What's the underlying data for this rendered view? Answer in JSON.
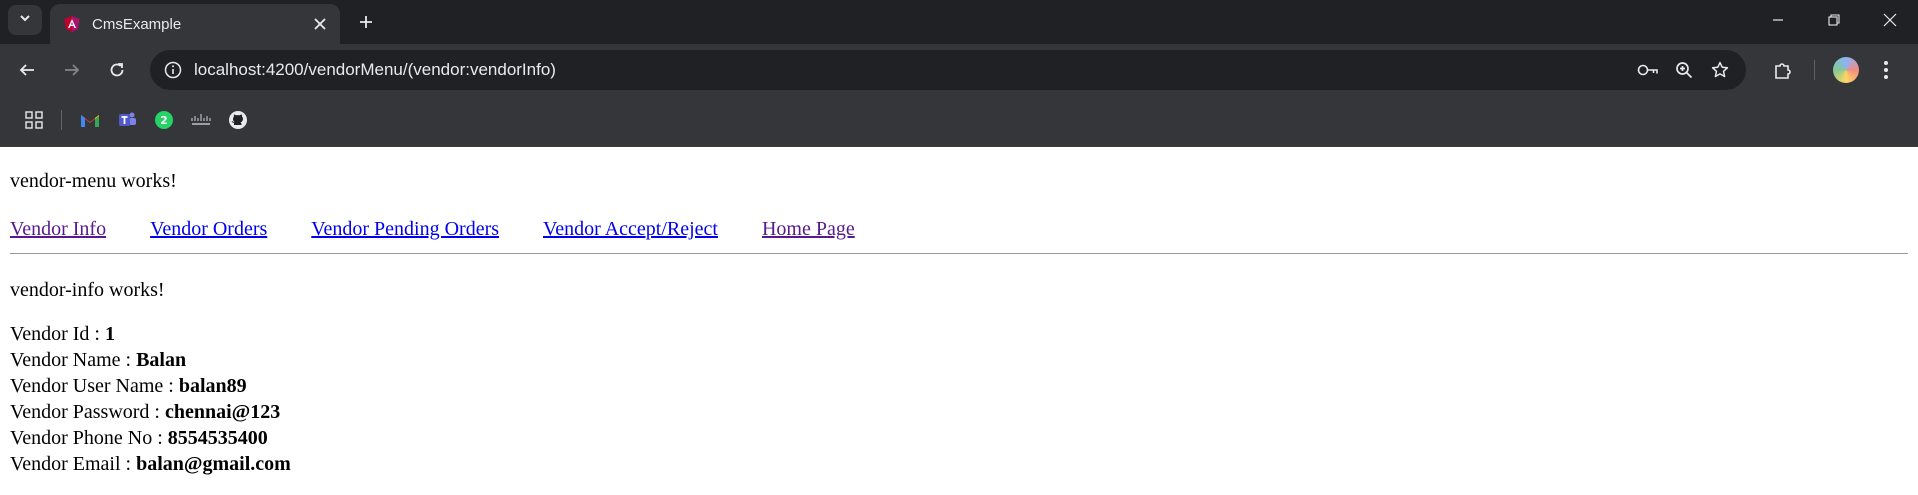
{
  "browser": {
    "tab_title": "CmsExample",
    "url": "localhost:4200/vendorMenu/(vendor:vendorInfo)"
  },
  "page": {
    "menu_heading": "vendor-menu works!",
    "nav_links": [
      "Vendor Info",
      "Vendor Orders",
      "Vendor Pending Orders",
      "Vendor Accept/Reject",
      "Home Page"
    ],
    "info_heading": "vendor-info works!",
    "fields": [
      {
        "label": "Vendor Id : ",
        "value": "1"
      },
      {
        "label": "Vendor Name : ",
        "value": "Balan"
      },
      {
        "label": "Vendor User Name : ",
        "value": "balan89"
      },
      {
        "label": "Vendor Password : ",
        "value": "chennai@123"
      },
      {
        "label": "Vendor Phone No : ",
        "value": "8554535400"
      },
      {
        "label": "Vendor Email : ",
        "value": "balan@gmail.com"
      }
    ]
  },
  "colors": {
    "link": "#0000ee",
    "visited_link": "#551a8b",
    "chrome_dark": "#202124",
    "chrome_toolbar": "#35363a"
  }
}
